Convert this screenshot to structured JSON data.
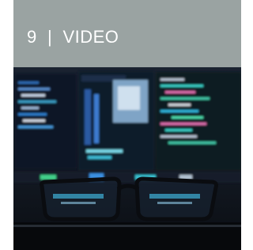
{
  "header": {
    "number": "9",
    "separator": "|",
    "label": "VIDEO",
    "background": "#9aa3a2",
    "text_color": "#ffffff"
  },
  "thumbnail": {
    "icon": "video-thumbnail-image",
    "description_hidden": true
  }
}
